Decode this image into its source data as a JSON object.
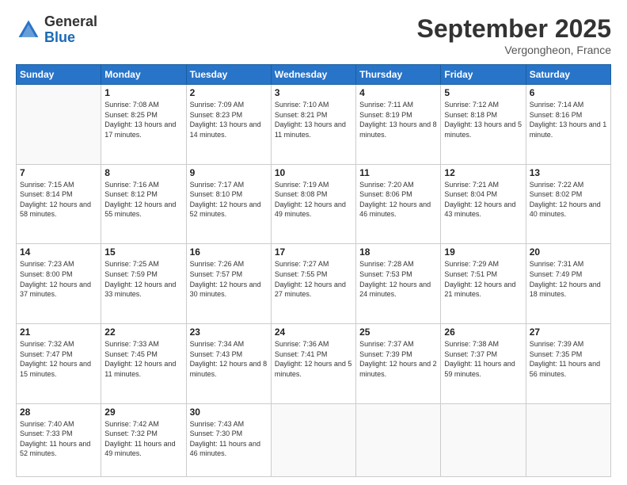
{
  "logo": {
    "line1": "General",
    "line2": "Blue"
  },
  "title": "September 2025",
  "location": "Vergongheon, France",
  "weekdays": [
    "Sunday",
    "Monday",
    "Tuesday",
    "Wednesday",
    "Thursday",
    "Friday",
    "Saturday"
  ],
  "weeks": [
    [
      {
        "day": "",
        "sunrise": "",
        "sunset": "",
        "daylight": ""
      },
      {
        "day": "1",
        "sunrise": "Sunrise: 7:08 AM",
        "sunset": "Sunset: 8:25 PM",
        "daylight": "Daylight: 13 hours and 17 minutes."
      },
      {
        "day": "2",
        "sunrise": "Sunrise: 7:09 AM",
        "sunset": "Sunset: 8:23 PM",
        "daylight": "Daylight: 13 hours and 14 minutes."
      },
      {
        "day": "3",
        "sunrise": "Sunrise: 7:10 AM",
        "sunset": "Sunset: 8:21 PM",
        "daylight": "Daylight: 13 hours and 11 minutes."
      },
      {
        "day": "4",
        "sunrise": "Sunrise: 7:11 AM",
        "sunset": "Sunset: 8:19 PM",
        "daylight": "Daylight: 13 hours and 8 minutes."
      },
      {
        "day": "5",
        "sunrise": "Sunrise: 7:12 AM",
        "sunset": "Sunset: 8:18 PM",
        "daylight": "Daylight: 13 hours and 5 minutes."
      },
      {
        "day": "6",
        "sunrise": "Sunrise: 7:14 AM",
        "sunset": "Sunset: 8:16 PM",
        "daylight": "Daylight: 13 hours and 1 minute."
      }
    ],
    [
      {
        "day": "7",
        "sunrise": "Sunrise: 7:15 AM",
        "sunset": "Sunset: 8:14 PM",
        "daylight": "Daylight: 12 hours and 58 minutes."
      },
      {
        "day": "8",
        "sunrise": "Sunrise: 7:16 AM",
        "sunset": "Sunset: 8:12 PM",
        "daylight": "Daylight: 12 hours and 55 minutes."
      },
      {
        "day": "9",
        "sunrise": "Sunrise: 7:17 AM",
        "sunset": "Sunset: 8:10 PM",
        "daylight": "Daylight: 12 hours and 52 minutes."
      },
      {
        "day": "10",
        "sunrise": "Sunrise: 7:19 AM",
        "sunset": "Sunset: 8:08 PM",
        "daylight": "Daylight: 12 hours and 49 minutes."
      },
      {
        "day": "11",
        "sunrise": "Sunrise: 7:20 AM",
        "sunset": "Sunset: 8:06 PM",
        "daylight": "Daylight: 12 hours and 46 minutes."
      },
      {
        "day": "12",
        "sunrise": "Sunrise: 7:21 AM",
        "sunset": "Sunset: 8:04 PM",
        "daylight": "Daylight: 12 hours and 43 minutes."
      },
      {
        "day": "13",
        "sunrise": "Sunrise: 7:22 AM",
        "sunset": "Sunset: 8:02 PM",
        "daylight": "Daylight: 12 hours and 40 minutes."
      }
    ],
    [
      {
        "day": "14",
        "sunrise": "Sunrise: 7:23 AM",
        "sunset": "Sunset: 8:00 PM",
        "daylight": "Daylight: 12 hours and 37 minutes."
      },
      {
        "day": "15",
        "sunrise": "Sunrise: 7:25 AM",
        "sunset": "Sunset: 7:59 PM",
        "daylight": "Daylight: 12 hours and 33 minutes."
      },
      {
        "day": "16",
        "sunrise": "Sunrise: 7:26 AM",
        "sunset": "Sunset: 7:57 PM",
        "daylight": "Daylight: 12 hours and 30 minutes."
      },
      {
        "day": "17",
        "sunrise": "Sunrise: 7:27 AM",
        "sunset": "Sunset: 7:55 PM",
        "daylight": "Daylight: 12 hours and 27 minutes."
      },
      {
        "day": "18",
        "sunrise": "Sunrise: 7:28 AM",
        "sunset": "Sunset: 7:53 PM",
        "daylight": "Daylight: 12 hours and 24 minutes."
      },
      {
        "day": "19",
        "sunrise": "Sunrise: 7:29 AM",
        "sunset": "Sunset: 7:51 PM",
        "daylight": "Daylight: 12 hours and 21 minutes."
      },
      {
        "day": "20",
        "sunrise": "Sunrise: 7:31 AM",
        "sunset": "Sunset: 7:49 PM",
        "daylight": "Daylight: 12 hours and 18 minutes."
      }
    ],
    [
      {
        "day": "21",
        "sunrise": "Sunrise: 7:32 AM",
        "sunset": "Sunset: 7:47 PM",
        "daylight": "Daylight: 12 hours and 15 minutes."
      },
      {
        "day": "22",
        "sunrise": "Sunrise: 7:33 AM",
        "sunset": "Sunset: 7:45 PM",
        "daylight": "Daylight: 12 hours and 11 minutes."
      },
      {
        "day": "23",
        "sunrise": "Sunrise: 7:34 AM",
        "sunset": "Sunset: 7:43 PM",
        "daylight": "Daylight: 12 hours and 8 minutes."
      },
      {
        "day": "24",
        "sunrise": "Sunrise: 7:36 AM",
        "sunset": "Sunset: 7:41 PM",
        "daylight": "Daylight: 12 hours and 5 minutes."
      },
      {
        "day": "25",
        "sunrise": "Sunrise: 7:37 AM",
        "sunset": "Sunset: 7:39 PM",
        "daylight": "Daylight: 12 hours and 2 minutes."
      },
      {
        "day": "26",
        "sunrise": "Sunrise: 7:38 AM",
        "sunset": "Sunset: 7:37 PM",
        "daylight": "Daylight: 11 hours and 59 minutes."
      },
      {
        "day": "27",
        "sunrise": "Sunrise: 7:39 AM",
        "sunset": "Sunset: 7:35 PM",
        "daylight": "Daylight: 11 hours and 56 minutes."
      }
    ],
    [
      {
        "day": "28",
        "sunrise": "Sunrise: 7:40 AM",
        "sunset": "Sunset: 7:33 PM",
        "daylight": "Daylight: 11 hours and 52 minutes."
      },
      {
        "day": "29",
        "sunrise": "Sunrise: 7:42 AM",
        "sunset": "Sunset: 7:32 PM",
        "daylight": "Daylight: 11 hours and 49 minutes."
      },
      {
        "day": "30",
        "sunrise": "Sunrise: 7:43 AM",
        "sunset": "Sunset: 7:30 PM",
        "daylight": "Daylight: 11 hours and 46 minutes."
      },
      {
        "day": "",
        "sunrise": "",
        "sunset": "",
        "daylight": ""
      },
      {
        "day": "",
        "sunrise": "",
        "sunset": "",
        "daylight": ""
      },
      {
        "day": "",
        "sunrise": "",
        "sunset": "",
        "daylight": ""
      },
      {
        "day": "",
        "sunrise": "",
        "sunset": "",
        "daylight": ""
      }
    ]
  ]
}
